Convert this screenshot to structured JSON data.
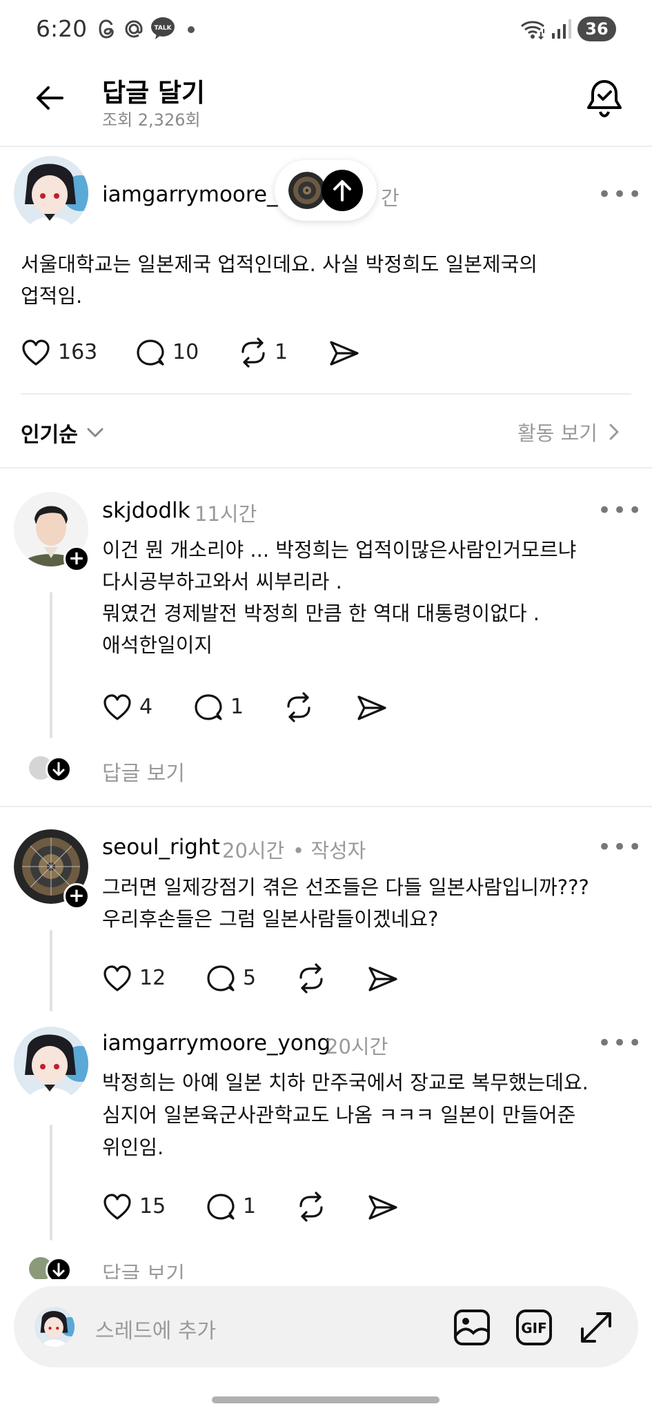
{
  "status_bar": {
    "time": "6:20",
    "notif_icons": [
      "threads-icon",
      "at-icon",
      "kakaotalk-icon",
      "dot-icon"
    ],
    "talk_badge": "TALK",
    "battery": "36"
  },
  "header": {
    "title": "답글 달기",
    "views": "조회 2,326회"
  },
  "main_post": {
    "username": "iamgarrymoore_y",
    "time_fragment": "간",
    "text_line1": "서울대학교는 일본제국 업적인데요. 사실 박정희도 일본제국의",
    "text_line2": "업적임.",
    "likes": "163",
    "comments": "10",
    "reposts": "1"
  },
  "sort_bar": {
    "sort_label": "인기순",
    "activity_label": "활동 보기"
  },
  "replies": [
    {
      "username": "skjdodlk",
      "time": "11시간",
      "lines": [
        "이건 뭔 개소리야 ... 박정희는 업적이많은사람인거모르냐",
        "다시공부하고와서 씨부리라 .",
        "뭐였건 경제발전 박정희 만큼 한 역대 대통령이없다 .",
        "애석한일이지"
      ],
      "likes": "4",
      "comments": "1",
      "view_replies": "답글 보기"
    },
    {
      "username": "seoul_right",
      "time": "20시간",
      "author_tag": "• 작성자",
      "lines": [
        "그러면 일제강점기 겪은 선조들은 다들 일본사람입니까???",
        "우리후손들은 그럼 일본사람들이겠네요?"
      ],
      "likes": "12",
      "comments": "5"
    },
    {
      "username": "iamgarrymoore_yong",
      "time": "20시간",
      "lines": [
        "박정희는 아예 일본 치하 만주국에서 장교로 복무했는데요.",
        "심지어 일본육군사관학교도 나옴 ㅋㅋㅋ 일본이 만들어준",
        "위인임."
      ],
      "likes": "15",
      "comments": "1",
      "view_replies": "답글 보기"
    }
  ],
  "composer": {
    "placeholder": "스레드에 추가",
    "gif_label": "GIF"
  },
  "colors": {
    "text": "#000000",
    "muted": "#999999",
    "divider": "#ececec",
    "composer_bg": "#f1f1f1"
  }
}
